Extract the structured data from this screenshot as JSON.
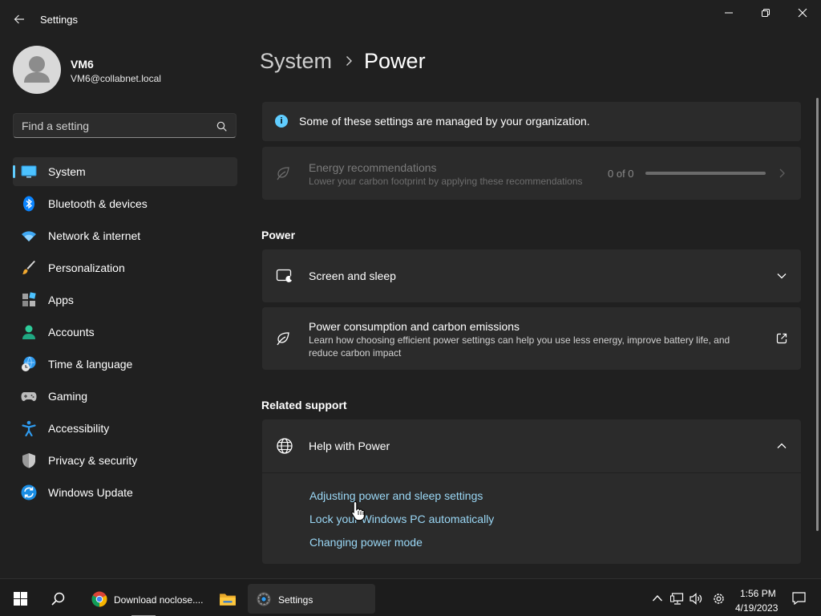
{
  "window": {
    "title": "Settings",
    "icons": {
      "back": "arrow-left-icon",
      "minimize": "minimize-icon",
      "restore": "restore-icon",
      "close": "close-icon"
    }
  },
  "profile": {
    "name": "VM6",
    "email": "VM6@collabnet.local",
    "avatar_icon": "person-silhouette-icon"
  },
  "search": {
    "placeholder": "Find a setting",
    "value": "",
    "icon": "search-icon"
  },
  "sidebar": {
    "accent": "#60cdff",
    "items": [
      {
        "label": "System",
        "icon": "monitor-icon",
        "selected": true
      },
      {
        "label": "Bluetooth & devices",
        "icon": "bluetooth-icon",
        "selected": false
      },
      {
        "label": "Network & internet",
        "icon": "wifi-icon",
        "selected": false
      },
      {
        "label": "Personalization",
        "icon": "paintbrush-icon",
        "selected": false
      },
      {
        "label": "Apps",
        "icon": "apps-grid-icon",
        "selected": false
      },
      {
        "label": "Accounts",
        "icon": "accounts-person-icon",
        "selected": false
      },
      {
        "label": "Time & language",
        "icon": "globe-clock-icon",
        "selected": false
      },
      {
        "label": "Gaming",
        "icon": "gamepad-icon",
        "selected": false
      },
      {
        "label": "Accessibility",
        "icon": "accessibility-icon",
        "selected": false
      },
      {
        "label": "Privacy & security",
        "icon": "shield-icon",
        "selected": false
      },
      {
        "label": "Windows Update",
        "icon": "windows-update-icon",
        "selected": false
      }
    ]
  },
  "main": {
    "breadcrumb": {
      "parent": "System",
      "current": "Power"
    },
    "info_bar": {
      "text": "Some of these settings are managed by your organization.",
      "icon": "info-icon"
    },
    "energy": {
      "title": "Energy recommendations",
      "description": "Lower your carbon footprint by applying these recommendations",
      "count_text": "0 of 0",
      "progress": 0,
      "icon": "leaf-icon"
    },
    "power_section": {
      "header": "Power",
      "screen_sleep": {
        "title": "Screen and sleep",
        "icon": "screen-sleep-icon",
        "expanded": false
      },
      "power_consumption": {
        "title": "Power consumption and carbon emissions",
        "description": "Learn how choosing efficient power settings can help you use less energy, improve battery life, and reduce carbon impact",
        "icon": "leaf-icon"
      }
    },
    "related_support": {
      "header": "Related support",
      "help": {
        "title": "Help with Power",
        "icon": "globe-icon",
        "expanded": true,
        "links": [
          "Adjusting power and sleep settings",
          "Lock your Windows PC automatically",
          "Changing power mode"
        ]
      }
    }
  },
  "taskbar": {
    "start_icon": "windows-logo-icon",
    "search_icon": "search-icon",
    "apps": [
      {
        "label": "Download noclose....",
        "icon": "chrome-icon"
      },
      {
        "label": "",
        "icon": "folder-icon"
      },
      {
        "label": "Settings",
        "icon": "gear-icon",
        "active": true
      }
    ],
    "tray_icons": [
      "chevron-up-icon",
      "network-icon",
      "volume-icon",
      "gear-icon"
    ],
    "time": "1:56 PM",
    "date": "4/19/2023",
    "notification_icon": "notification-icon"
  }
}
